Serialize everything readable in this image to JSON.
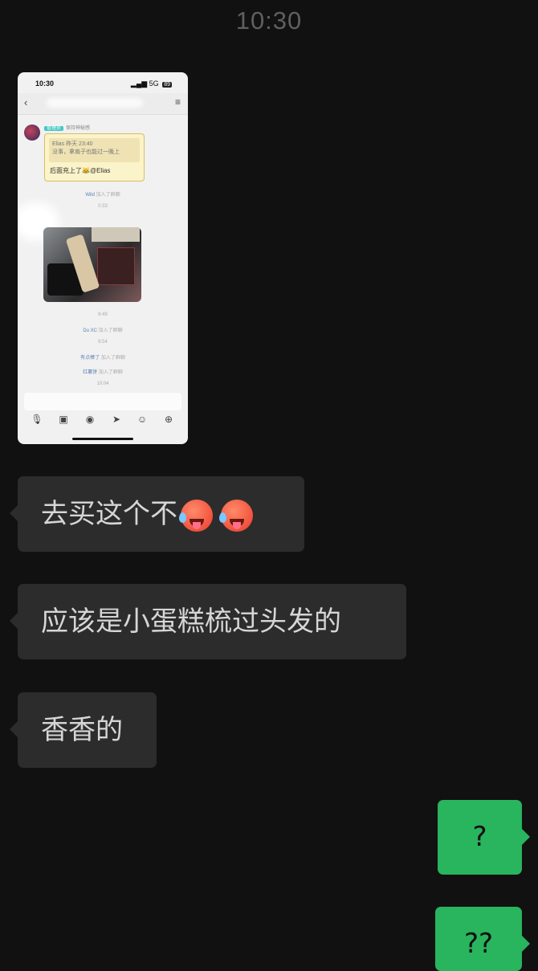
{
  "status": {
    "time": "10:30"
  },
  "screenshot_message": {
    "status_time": "10:30",
    "status_right": "5G",
    "battery": "89",
    "back_icon": "chevron-left-icon",
    "menu_icon": "menu-icon",
    "tag_badge": "管理员",
    "tag_nick": "保持神秘感",
    "quote_line1": "Elias 昨天 23:40",
    "quote_line2": "没事，拿扇子也能过一晚上",
    "reply_text": "后面充上了😹@Elias",
    "sys1_who": "Wild",
    "sys1_action": "加入了群聊",
    "time1": "0:33",
    "time2": "9:49",
    "sys2_who": "Du XC",
    "sys2_action": "加入了群聊",
    "time3": "9:54",
    "sys3_who": "有点棒了",
    "sys3_action": "加入了群聊",
    "sys4_who": "红薯饼",
    "sys4_action": "加入了群聊",
    "time4": "10:04"
  },
  "messages": [
    {
      "side": "left",
      "text": "去买这个不",
      "emoji": "hot-face-emoji x2"
    },
    {
      "side": "left",
      "text": "应该是小蛋糕梳过头发的"
    },
    {
      "side": "left",
      "text": "香香的"
    },
    {
      "side": "right",
      "text": "?"
    },
    {
      "side": "right",
      "text": "??"
    }
  ],
  "colors": {
    "background": "#111111",
    "incoming_bubble": "#2c2c2c",
    "outgoing_bubble": "#29b45e"
  }
}
